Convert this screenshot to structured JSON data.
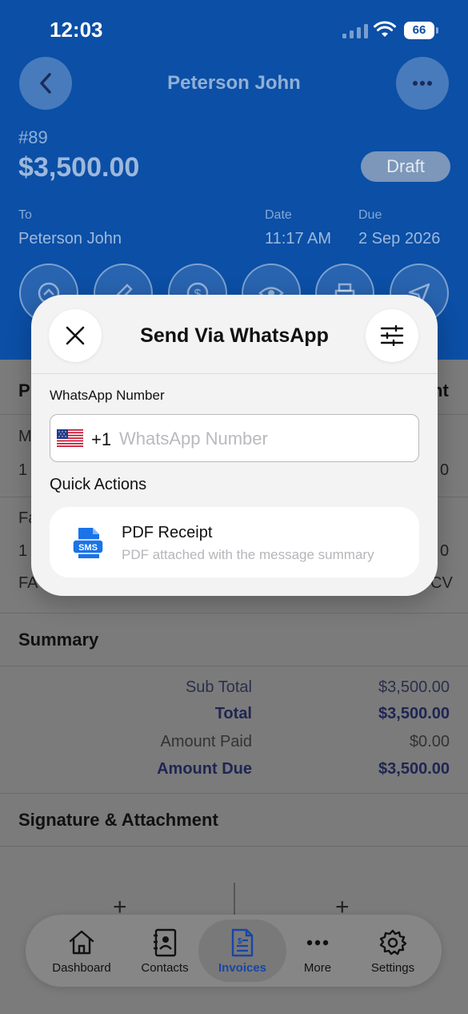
{
  "status_bar": {
    "time": "12:03",
    "battery": "66"
  },
  "header": {
    "title": "Peterson John",
    "invoice_number": "#89",
    "amount": "$3,500.00",
    "status": "Draft",
    "to_label": "To",
    "to_value": "Peterson John",
    "date_label": "Date",
    "date_value": "11:17 AM",
    "due_label": "Due",
    "due_value": "2 Sep 2026"
  },
  "background": {
    "items_header_left": "P",
    "items_header_right": "nt",
    "row1_left": "M",
    "row1_qty": "1",
    "row1_right": "0",
    "row2_left": "Fa",
    "row2_qty": "1",
    "row2_right": "0",
    "row3_left": "FA",
    "row3_right": "CV"
  },
  "summary": {
    "title": "Summary",
    "rows": [
      {
        "label": "Sub Total",
        "value": "$3,500.00"
      },
      {
        "label": "Total",
        "value": "$3,500.00"
      },
      {
        "label": "Amount Paid",
        "value": "$0.00"
      },
      {
        "label": "Amount Due",
        "value": "$3,500.00"
      }
    ]
  },
  "signature": {
    "title": "Signature & Attachment",
    "add_symbol": "+"
  },
  "tabs": [
    {
      "label": "Dashboard",
      "icon": "home-icon"
    },
    {
      "label": "Contacts",
      "icon": "contacts-icon"
    },
    {
      "label": "Invoices",
      "icon": "invoice-icon",
      "active": true
    },
    {
      "label": "More",
      "icon": "ellipsis-icon"
    },
    {
      "label": "Settings",
      "icon": "gear-icon"
    }
  ],
  "modal": {
    "title": "Send Via WhatsApp",
    "field_label": "WhatsApp Number",
    "country_code": "+1",
    "placeholder": "WhatsApp Number",
    "value": "",
    "quick_actions_title": "Quick Actions",
    "quick_action": {
      "name": "PDF Receipt",
      "description": "PDF attached with the message summary",
      "icon_text": "SMS"
    }
  },
  "colors": {
    "header_blue": "#0b4fa6",
    "accent_blue": "#1746a6",
    "sms_icon_blue": "#1a73e8"
  }
}
